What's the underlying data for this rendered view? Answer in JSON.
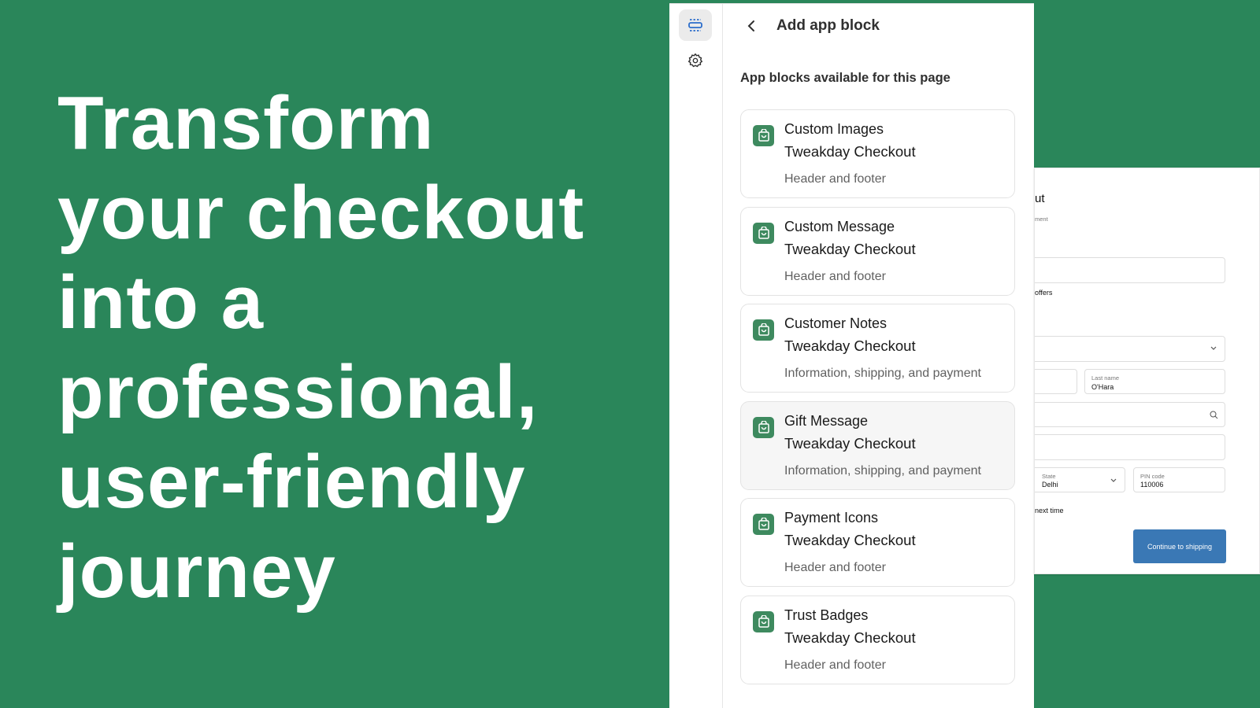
{
  "hero": {
    "lines": [
      "Transform",
      "your checkout",
      "into a",
      "professional,",
      "user-friendly",
      "journey"
    ]
  },
  "rail": {
    "items": [
      {
        "icon": "sections-icon",
        "active": true
      },
      {
        "icon": "gear-icon"
      }
    ]
  },
  "panel": {
    "title": "Add app block",
    "subtitle": "App blocks available for this page",
    "blocks": [
      {
        "name": "Custom Images",
        "app": "Tweakday Checkout",
        "target": "Header and footer"
      },
      {
        "name": "Custom Message",
        "app": "Tweakday Checkout",
        "target": "Header and footer"
      },
      {
        "name": "Customer Notes",
        "app": "Tweakday Checkout",
        "target": "Information, shipping, and payment"
      },
      {
        "name": "Gift Message",
        "app": "Tweakday Checkout",
        "target": "Information, shipping, and payment"
      },
      {
        "name": "Payment Icons",
        "app": "Tweakday Checkout",
        "target": "Header and footer"
      },
      {
        "name": "Trust Badges",
        "app": "Tweakday Checkout",
        "target": "Header and footer"
      }
    ],
    "icon_color": "#3e8a5f"
  },
  "checkout": {
    "title_fragment": "ut",
    "subtitle_fragment": "ment",
    "offers_fragment": "offers",
    "last_name_label": "Last name",
    "last_name_value": "O'Hara",
    "state_label": "State",
    "state_value": "Delhi",
    "pin_label": "PIN code",
    "pin_value": "110006",
    "save_fragment": "next time",
    "continue_label": "Continue to shipping",
    "button_color": "#3a78b5"
  }
}
